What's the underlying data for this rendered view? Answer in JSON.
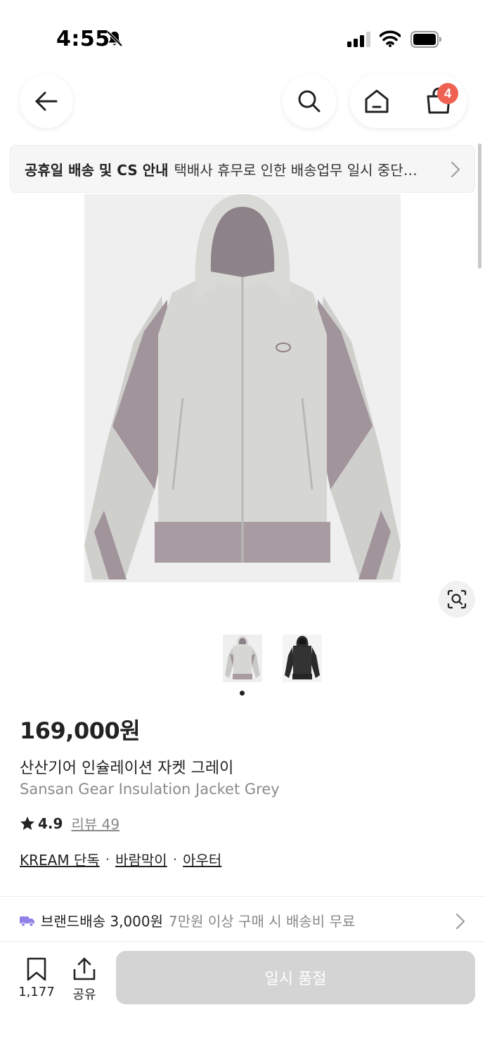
{
  "status_bar": {
    "time": "4:55"
  },
  "nav": {
    "cart_count": "4"
  },
  "notice": {
    "title": "공휴일 배송 및 CS 안내",
    "text": "택배사 휴무로 인한 배송업무 일시 중단…"
  },
  "gallery": {
    "thumbnails": [
      "grey-jacket",
      "black-jacket"
    ],
    "active_index": 0
  },
  "product": {
    "price": "169,000원",
    "name_ko": "산산기어 인슐레이션 자켓 그레이",
    "name_en": "Sansan Gear Insulation Jacket Grey",
    "rating": "4.9",
    "review_label": "리뷰 49",
    "tags": [
      "KREAM 단독",
      "바람막이",
      "아우터"
    ],
    "tag_separator": "·"
  },
  "shipping": {
    "label": "브랜드배송 3,000원",
    "note": "7만원 이상 구매 시 배송비 무료"
  },
  "bottom_bar": {
    "bookmark_count": "1,177",
    "share_label": "공유",
    "action_label": "일시 품절"
  },
  "colors": {
    "badge": "#ef6253",
    "truck": "#8f82e6",
    "soldout_button": "#d4d4d4"
  }
}
